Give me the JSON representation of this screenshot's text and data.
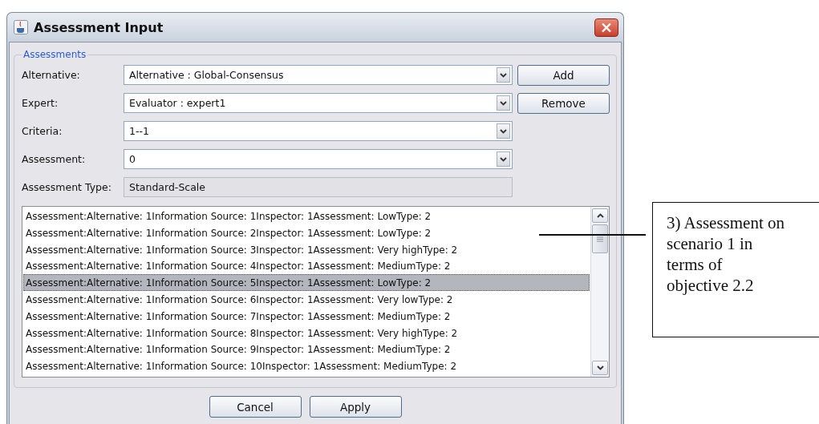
{
  "window": {
    "title": "Assessment Input"
  },
  "group": {
    "title": "Assessments"
  },
  "fields": [
    {
      "kind": "combo",
      "label": "Alternative:",
      "value": "Alternative : Global-Consensus"
    },
    {
      "kind": "combo",
      "label": "Expert:",
      "value": "Evaluator : expert1"
    },
    {
      "kind": "combo",
      "label": "Criteria:",
      "value": "1--1"
    },
    {
      "kind": "combo",
      "label": "Assessment:",
      "value": "0"
    },
    {
      "kind": "readonly",
      "label": "Assessment Type:",
      "value": "Standard-Scale"
    }
  ],
  "side_buttons": [
    "Add",
    "Remove"
  ],
  "list": {
    "rows": [
      {
        "text": "Assessment:Alternative: 1Information Source: 1Inspector: 1Assessment: LowType: 2",
        "selected": false
      },
      {
        "text": "Assessment:Alternative: 1Information Source: 2Inspector: 1Assessment: LowType: 2",
        "selected": false
      },
      {
        "text": "Assessment:Alternative: 1Information Source: 3Inspector: 1Assessment: Very highType: 2",
        "selected": false
      },
      {
        "text": "Assessment:Alternative: 1Information Source: 4Inspector: 1Assessment: MediumType: 2",
        "selected": false
      },
      {
        "text": "Assessment:Alternative: 1Information Source: 5Inspector: 1Assessment: LowType: 2",
        "selected": true
      },
      {
        "text": "Assessment:Alternative: 1Information Source: 6Inspector: 1Assessment: Very lowType: 2",
        "selected": false
      },
      {
        "text": "Assessment:Alternative: 1Information Source: 7Inspector: 1Assessment: MediumType: 2",
        "selected": false
      },
      {
        "text": "Assessment:Alternative: 1Information Source: 8Inspector: 1Assessment: Very highType: 2",
        "selected": false
      },
      {
        "text": "Assessment:Alternative: 1Information Source: 9Inspector: 1Assessment: MediumType: 2",
        "selected": false
      },
      {
        "text": "Assessment:Alternative: 1Information Source: 10Inspector: 1Assessment: MediumType: 2",
        "selected": false
      }
    ]
  },
  "buttons": [
    "Cancel",
    "Apply"
  ],
  "annotation": {
    "text": "3) Assessment on scenario 1 in terms of objective 2.2"
  }
}
